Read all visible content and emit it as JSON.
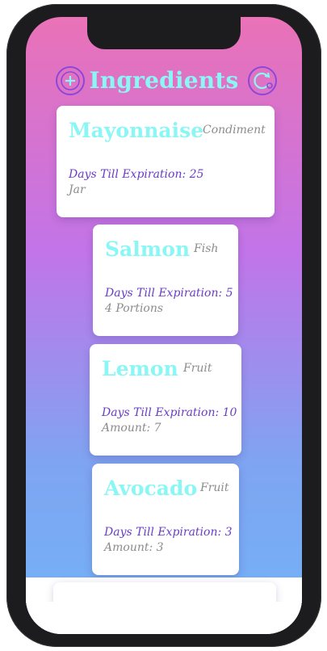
{
  "header": {
    "title": "Ingredients",
    "add_icon": "plus-circle-icon",
    "refresh_icon": "refresh-icon"
  },
  "ingredients": [
    {
      "name": "Mayonnaise",
      "category": "Condiment",
      "expiration": "Days Till Expiration: 25",
      "amount": "Jar"
    },
    {
      "name": "Salmon",
      "category": "Fish",
      "expiration": "Days Till Expiration: 5",
      "amount": "4 Portions"
    },
    {
      "name": "Lemon",
      "category": "Fruit",
      "expiration": "Days Till Expiration: 10",
      "amount": "Amount: 7"
    },
    {
      "name": "Avocado",
      "category": "Fruit",
      "expiration": "Days Till Expiration: 3",
      "amount": "Amount: 3"
    }
  ],
  "colors": {
    "gradient_top": "#ea72b7",
    "gradient_mid": "#c274e8",
    "gradient_bottom": "#72b3f7",
    "title": "#8af7f4",
    "expiration_text": "#6a3cc8",
    "muted_text": "#8c8c8c"
  }
}
